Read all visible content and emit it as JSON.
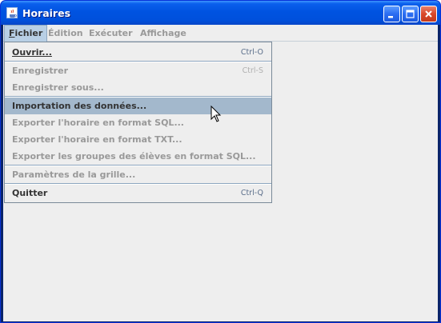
{
  "window": {
    "title": "Horaires",
    "icon": "java-cup-icon"
  },
  "menubar": {
    "items": [
      {
        "label": "Fichier",
        "mnemonic": "F",
        "rest": "ichier"
      },
      {
        "label": "Édition"
      },
      {
        "label": "Exécuter"
      },
      {
        "label": "Affichage"
      }
    ]
  },
  "file_menu": {
    "items": [
      {
        "label": "Ouvrir...",
        "accel": "Ctrl-O",
        "enabled": true
      },
      {
        "label": "Enregistrer",
        "accel": "Ctrl-S",
        "enabled": false
      },
      {
        "label": "Enregistrer sous...",
        "accel": "",
        "enabled": false
      },
      {
        "label": "Importation des données...",
        "accel": "",
        "enabled": true,
        "selected": true
      },
      {
        "label": "Exporter l'horaire en format SQL...",
        "accel": "",
        "enabled": false
      },
      {
        "label": "Exporter l'horaire en format TXT...",
        "accel": "",
        "enabled": false
      },
      {
        "label": "Exporter les groupes des élèves en format SQL...",
        "accel": "",
        "enabled": false
      },
      {
        "label": "Paramètres de la grille...",
        "accel": "",
        "enabled": false
      },
      {
        "label": "Quitter",
        "accel": "Ctrl-Q",
        "enabled": true
      }
    ]
  },
  "colors": {
    "titlebar": "#0053e1",
    "menu_bg": "#eeeeee",
    "selection": "#a3b8cc",
    "disabled_text": "#999999"
  }
}
